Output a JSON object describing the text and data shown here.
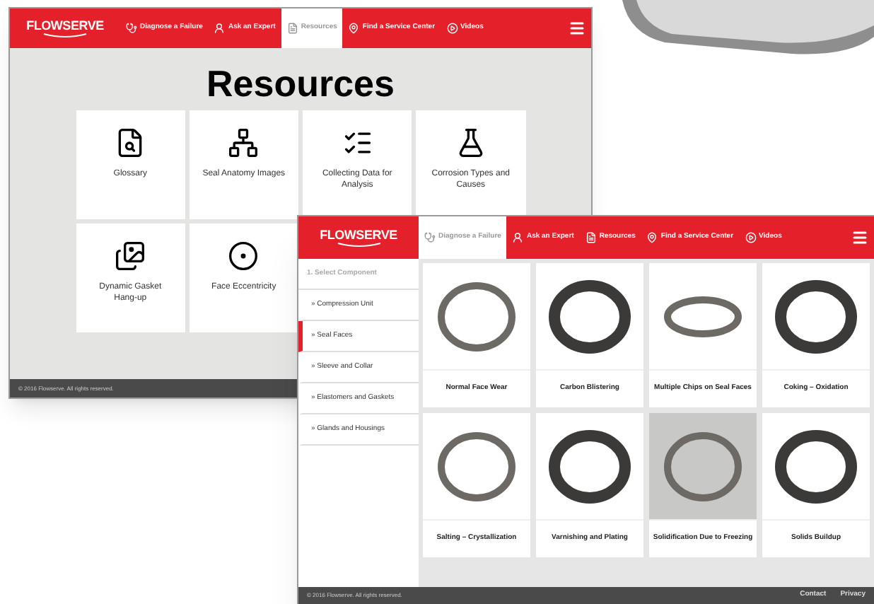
{
  "back_screen": {
    "logo": "FLOWSERVE",
    "nav": [
      {
        "label": "Diagnose a Failure",
        "selected": false
      },
      {
        "label": "Ask an Expert",
        "selected": false
      },
      {
        "label": "Resources",
        "selected": true
      },
      {
        "label": "Find a Service Center",
        "selected": false
      },
      {
        "label": "Videos",
        "selected": false
      }
    ],
    "heading": "Resources",
    "tiles": [
      {
        "label": "Glossary"
      },
      {
        "label": "Seal Anatomy Images"
      },
      {
        "label": "Collecting Data for Analysis"
      },
      {
        "label": "Corrosion Types and Causes"
      },
      {
        "label": "Dynamic Gasket Hang-up"
      },
      {
        "label": "Face Eccentricity"
      }
    ],
    "footer": "© 2016 Flowserve. All rights reserved."
  },
  "front_screen": {
    "logo": "FLOWSERVE",
    "nav": [
      {
        "label": "Diagnose a Failure",
        "selected": true
      },
      {
        "label": "Ask an Expert",
        "selected": false
      },
      {
        "label": "Resources",
        "selected": false
      },
      {
        "label": "Find a Service Center",
        "selected": false
      },
      {
        "label": "Videos",
        "selected": false
      }
    ],
    "sidebar_heading": "1. Select Component",
    "sidebar": [
      {
        "label": "» Compression Unit",
        "selected": false
      },
      {
        "label": "» Seal Faces",
        "selected": true
      },
      {
        "label": "» Sleeve and Collar",
        "selected": false
      },
      {
        "label": "» Elastomers and Gaskets",
        "selected": false
      },
      {
        "label": "» Glands and Housings",
        "selected": false
      }
    ],
    "cards": [
      {
        "caption": "Normal Face Wear"
      },
      {
        "caption": "Carbon Blistering"
      },
      {
        "caption": "Multiple Chips on Seal Faces"
      },
      {
        "caption": "Coking – Oxidation"
      },
      {
        "caption": "Salting – Crystallization"
      },
      {
        "caption": "Varnishing and Plating"
      },
      {
        "caption": "Solidification Due to Freezing"
      },
      {
        "caption": "Solids Buildup"
      }
    ],
    "footer": "© 2016 Flowserve. All rights reserved.",
    "footer_links": [
      "Contact",
      "Privacy"
    ]
  }
}
